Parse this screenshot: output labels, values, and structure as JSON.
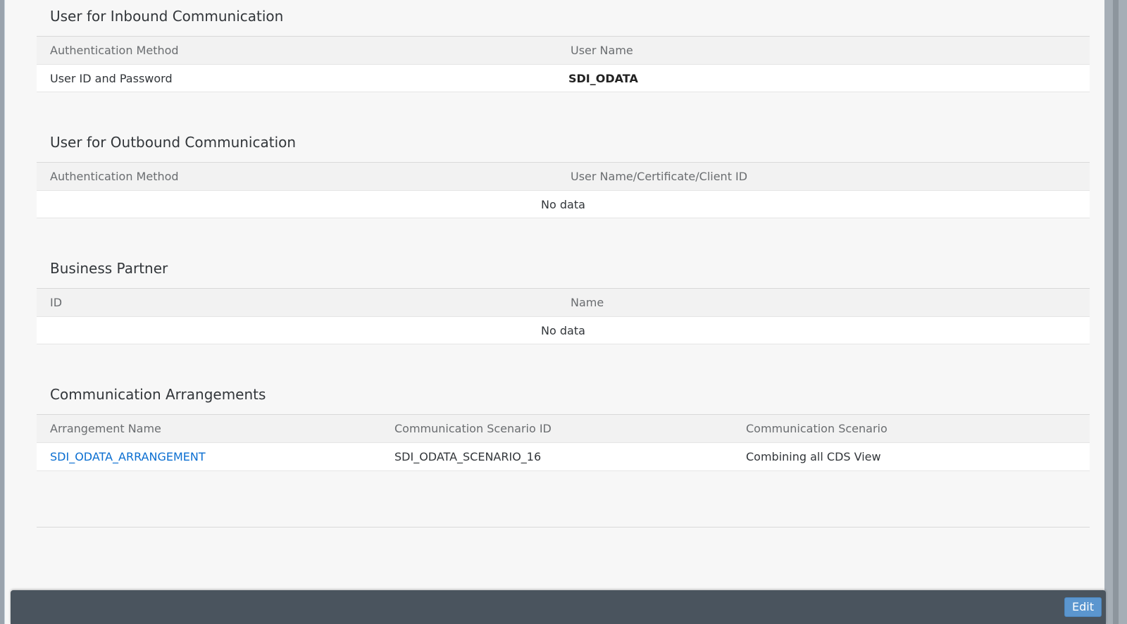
{
  "inbound": {
    "title": "User for Inbound Communication",
    "columns": [
      "Authentication Method",
      "User Name"
    ],
    "row": {
      "auth_method": "User ID and Password",
      "user_name": "SDI_ODATA"
    }
  },
  "outbound": {
    "title": "User for Outbound Communication",
    "columns": [
      "Authentication Method",
      "User Name/Certificate/Client ID"
    ],
    "empty_text": "No data"
  },
  "business_partner": {
    "title": "Business Partner",
    "columns": [
      "ID",
      "Name"
    ],
    "empty_text": "No data"
  },
  "arrangements": {
    "title": "Communication Arrangements",
    "columns": [
      "Arrangement Name",
      "Communication Scenario ID",
      "Communication Scenario"
    ],
    "rows": [
      {
        "name": "SDI_ODATA_ARRANGEMENT",
        "scenario_id": "SDI_ODATA_SCENARIO_16",
        "scenario": "Combining all CDS View"
      }
    ]
  },
  "footer": {
    "edit_label": "Edit"
  },
  "colors": {
    "link": "#0a6ed1",
    "footer_bar": "#4a545e",
    "edit_button": "#5b96cf"
  }
}
